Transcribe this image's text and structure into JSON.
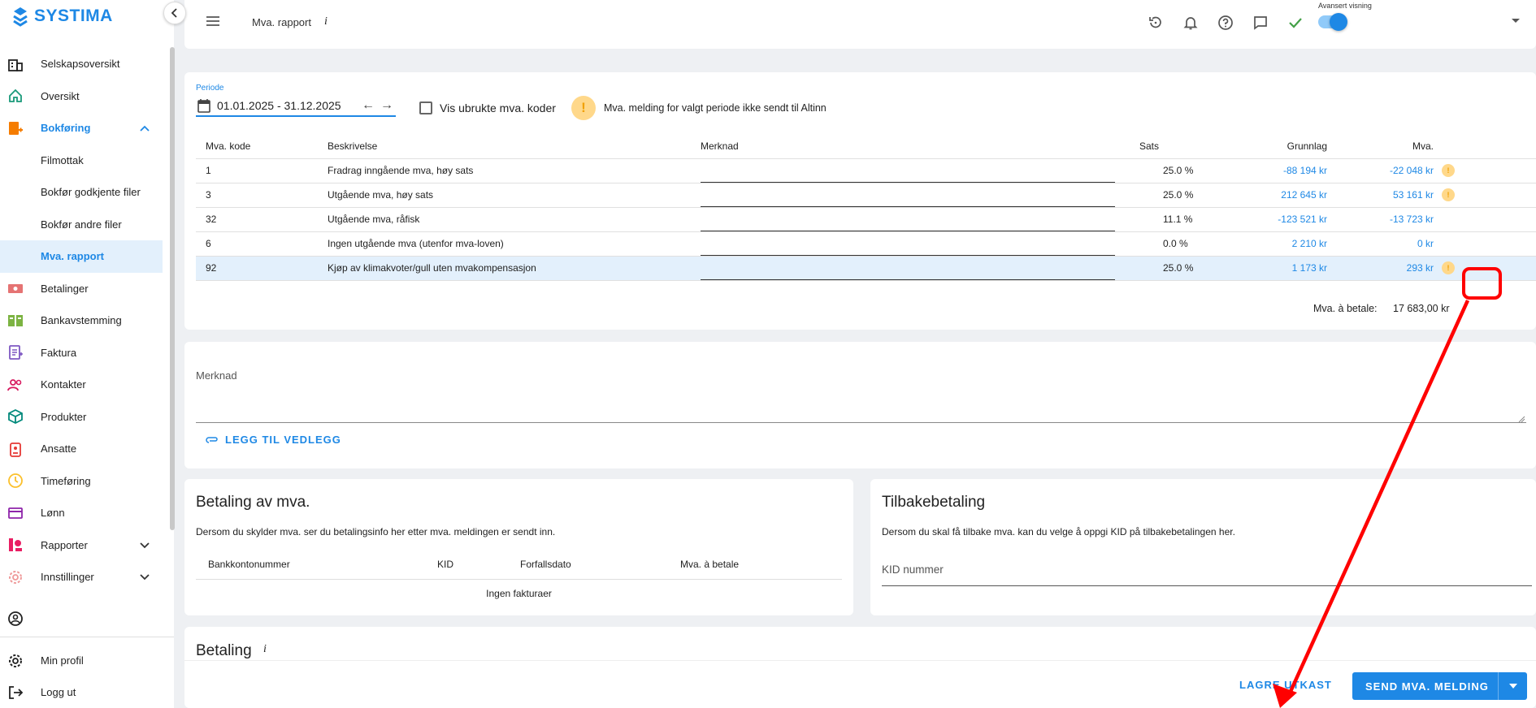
{
  "brand": {
    "name": "SYSTIMA"
  },
  "sidebar": {
    "items": [
      {
        "label": "Selskapsoversikt",
        "icon": "building-icon"
      },
      {
        "label": "Oversikt",
        "icon": "home-icon"
      },
      {
        "label": "Bokføring",
        "icon": "bookkeeping-icon",
        "expanded": true
      },
      {
        "label": "Filmottak",
        "sub": true
      },
      {
        "label": "Bokfør godkjente filer",
        "sub": true
      },
      {
        "label": "Bokfør andre filer",
        "sub": true
      },
      {
        "label": "Mva. rapport",
        "sub": true,
        "active": true
      },
      {
        "label": "Betalinger",
        "icon": "payments-icon"
      },
      {
        "label": "Bankavstemming",
        "icon": "bank-reconcile-icon"
      },
      {
        "label": "Faktura",
        "icon": "invoice-icon"
      },
      {
        "label": "Kontakter",
        "icon": "contacts-icon"
      },
      {
        "label": "Produkter",
        "icon": "products-icon"
      },
      {
        "label": "Ansatte",
        "icon": "employees-icon"
      },
      {
        "label": "Timeføring",
        "icon": "clock-icon"
      },
      {
        "label": "Lønn",
        "icon": "salary-icon"
      },
      {
        "label": "Rapporter",
        "icon": "reports-icon"
      },
      {
        "label": "Innstillinger",
        "icon": "settings-icon"
      }
    ],
    "bottom": [
      {
        "label": "Min profil",
        "icon": "gear-icon"
      },
      {
        "label": "Logg ut",
        "icon": "logout-icon"
      }
    ]
  },
  "topbar": {
    "title": "Mva. rapport",
    "info": "i",
    "advanced_label": "Avansert visning",
    "advanced_on": true
  },
  "period": {
    "label": "Periode",
    "value": "01.01.2025 - 31.12.2025",
    "checkbox_label": "Vis ubrukte mva. koder",
    "warning": "Mva. melding for valgt periode ikke sendt til Altinn"
  },
  "table": {
    "headers": [
      "Mva. kode",
      "Beskrivelse",
      "Merknad",
      "Sats",
      "Grunnlag",
      "Mva."
    ],
    "rows": [
      {
        "code": "1",
        "desc": "Fradrag inngående mva, høy sats",
        "sats": "25.0 %",
        "grunnlag": "-88 194 kr",
        "mva": "-22 048 kr",
        "warn": true
      },
      {
        "code": "3",
        "desc": "Utgående mva, høy sats",
        "sats": "25.0 %",
        "grunnlag": "212 645 kr",
        "mva": "53 161 kr",
        "warn": true
      },
      {
        "code": "32",
        "desc": "Utgående mva, råfisk",
        "sats": "11.1 %",
        "grunnlag": "-123 521 kr",
        "mva": "-13 723 kr",
        "warn": false
      },
      {
        "code": "6",
        "desc": "Ingen utgående mva (utenfor mva-loven)",
        "sats": "0.0 %",
        "grunnlag": "2 210 kr",
        "mva": "0 kr",
        "warn": false
      },
      {
        "code": "92",
        "desc": "Kjøp av klimakvoter/gull uten mvakompensasjon",
        "sats": "25.0 %",
        "grunnlag": "1 173 kr",
        "mva": "293 kr",
        "warn": true,
        "highlight": true
      }
    ],
    "total_label": "Mva. à betale:",
    "total_value": "17 683,00 kr"
  },
  "merknad": {
    "label": "Merknad",
    "attach": "LEGG TIL VEDLEGG"
  },
  "betaling_mva": {
    "title": "Betaling av mva.",
    "desc": "Dersom du skylder mva. ser du betalingsinfo her etter mva. meldingen er sendt inn.",
    "headers": [
      "Bankkontonummer",
      "KID",
      "Forfallsdato",
      "Mva. à betale"
    ],
    "empty": "Ingen fakturaer"
  },
  "tilbake": {
    "title": "Tilbakebetaling",
    "desc": "Dersom du skal få tilbake mva. kan du velge å oppgi KID på tilbakebetalingen her.",
    "kid_label": "KID nummer"
  },
  "betaling": {
    "title": "Betaling",
    "info": "i"
  },
  "footer": {
    "draft": "LAGRE UTKAST",
    "send": "SEND MVA. MELDING"
  },
  "colors": {
    "accent": "#1e88e5",
    "warn_bg": "#ffd88a",
    "annotation": "#ff0000"
  }
}
